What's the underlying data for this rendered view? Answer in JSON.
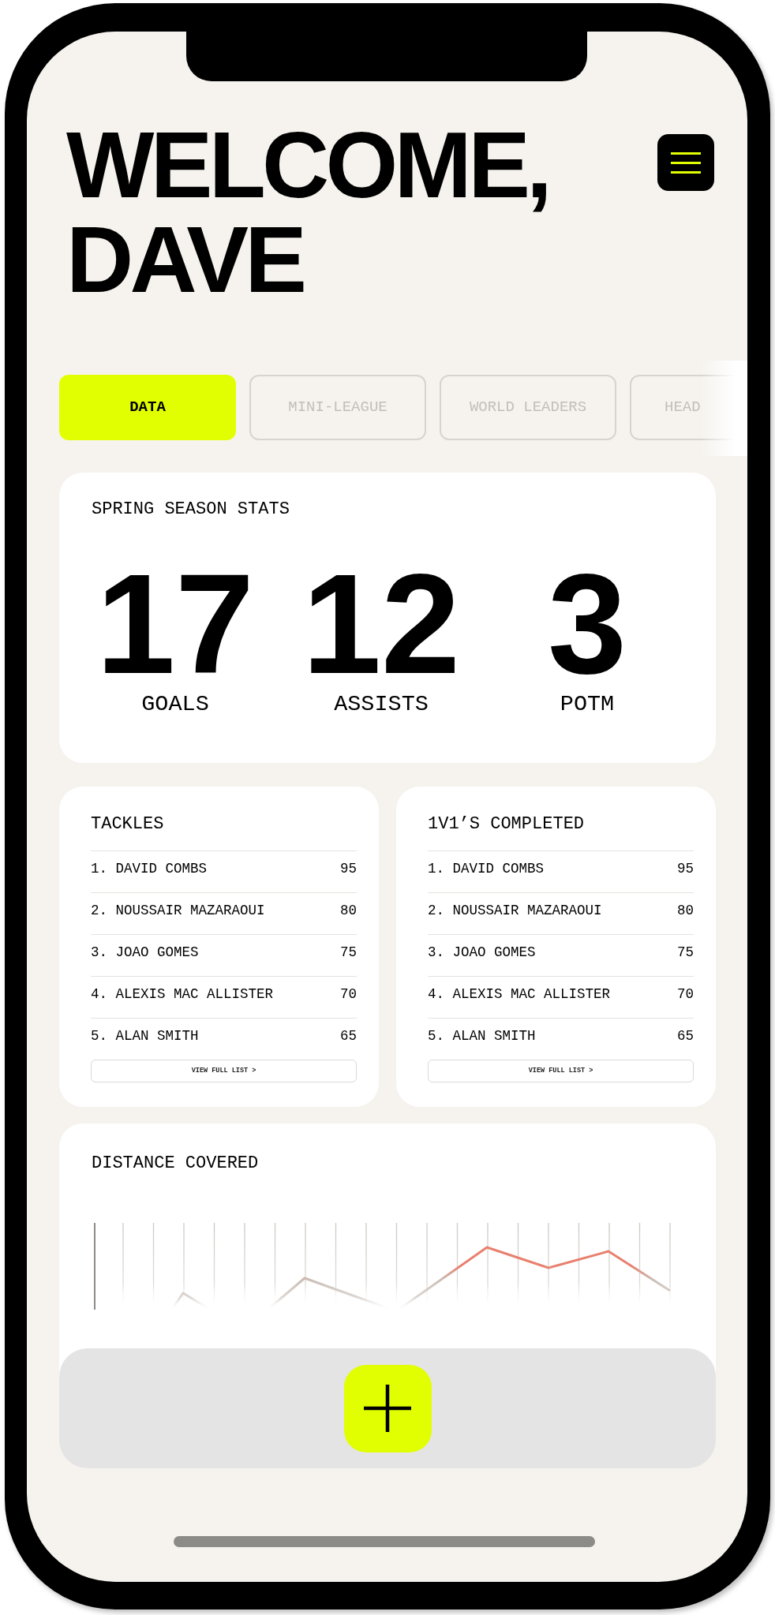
{
  "header": {
    "title": "WELCOME, DAVE"
  },
  "tabs": [
    {
      "label": "DATA",
      "selected": true
    },
    {
      "label": "MINI-LEAGUE",
      "selected": false
    },
    {
      "label": "WORLD LEADERS",
      "selected": false
    },
    {
      "label": "HEAD",
      "selected": false
    }
  ],
  "season_stats": {
    "title": "SPRING SEASON STATS",
    "stats": [
      {
        "value": "17",
        "label": "GOALS"
      },
      {
        "value": "12",
        "label": "ASSISTS"
      },
      {
        "value": "3",
        "label": "POTM"
      }
    ]
  },
  "leaderboards": [
    {
      "title": "TACKLES",
      "rows": [
        {
          "label": "1. DAVID COMBS",
          "value": "95"
        },
        {
          "label": "2. NOUSSAIR MAZARAOUI",
          "value": "80"
        },
        {
          "label": "3. JOAO GOMES",
          "value": "75"
        },
        {
          "label": "4. ALEXIS MAC ALLISTER",
          "value": "70"
        },
        {
          "label": "5. ALAN SMITH",
          "value": "65"
        }
      ],
      "button": "VIEW FULL LIST >"
    },
    {
      "title": "1V1’S COMPLETED",
      "rows": [
        {
          "label": "1. DAVID COMBS",
          "value": "95"
        },
        {
          "label": "2. NOUSSAIR MAZARAOUI",
          "value": "80"
        },
        {
          "label": "3. JOAO GOMES",
          "value": "75"
        },
        {
          "label": "4. ALEXIS MAC ALLISTER",
          "value": "70"
        },
        {
          "label": "5. ALAN SMITH",
          "value": "65"
        }
      ],
      "button": "VIEW FULL LIST >"
    }
  ],
  "distance": {
    "title": "DISTANCE COVERED"
  }
}
